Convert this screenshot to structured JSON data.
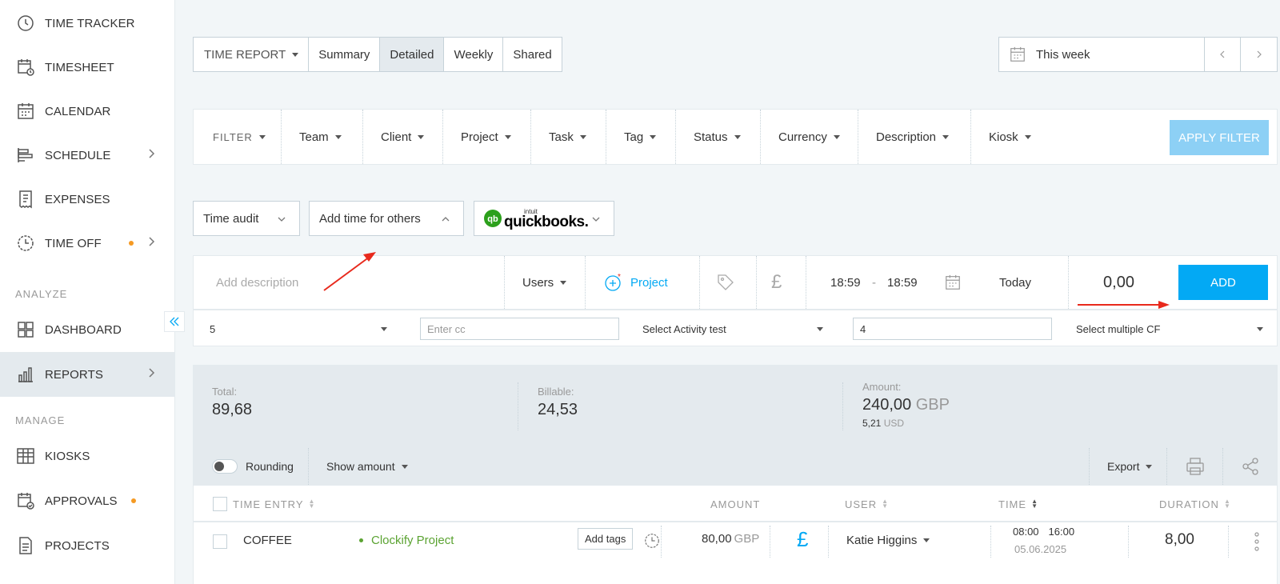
{
  "sidebar": {
    "items": [
      {
        "label": "TIME TRACKER"
      },
      {
        "label": "TIMESHEET"
      },
      {
        "label": "CALENDAR"
      },
      {
        "label": "SCHEDULE"
      },
      {
        "label": "EXPENSES"
      },
      {
        "label": "TIME OFF"
      },
      {
        "label": "DASHBOARD"
      },
      {
        "label": "REPORTS"
      },
      {
        "label": "KIOSKS"
      },
      {
        "label": "APPROVALS"
      },
      {
        "label": "PROJECTS"
      }
    ],
    "section_analyze": "ANALYZE",
    "section_manage": "MANAGE"
  },
  "report_tabs": {
    "type_label": "TIME REPORT",
    "tabs": [
      "Summary",
      "Detailed",
      "Weekly",
      "Shared"
    ],
    "active": "Detailed"
  },
  "date_range": {
    "label": "This week"
  },
  "filter": {
    "label": "FILTER",
    "items": [
      "Team",
      "Client",
      "Project",
      "Task",
      "Tag",
      "Status",
      "Currency",
      "Description",
      "Kiosk"
    ],
    "apply_label": "APPLY FILTER"
  },
  "actions": {
    "time_audit": "Time audit",
    "add_time_others": "Add time for others",
    "quickbooks_small": "intuit",
    "quickbooks": "quickbooks."
  },
  "entry": {
    "description_placeholder": "Add description",
    "users": "Users",
    "project": "Project",
    "currency_symbol": "£",
    "start": "18:59",
    "dash": "-",
    "end": "18:59",
    "date": "Today",
    "duration": "0,00",
    "add_label": "ADD"
  },
  "custom_fields": {
    "number_value": "5",
    "cc_placeholder": "Enter cc",
    "activity": "Select Activity test",
    "text_value": "4",
    "multi_cf": "Select multiple CF"
  },
  "totals": {
    "total_label": "Total:",
    "total_value": "89,68",
    "billable_label": "Billable:",
    "billable_value": "24,53",
    "amount_label": "Amount:",
    "amount_value": "240,00",
    "amount_currency": "GBP",
    "amount_secondary": "5,21",
    "amount_secondary_currency": "USD"
  },
  "toolbar": {
    "rounding": "Rounding",
    "show_amount": "Show amount",
    "export": "Export"
  },
  "table": {
    "headers": {
      "time_entry": "TIME ENTRY",
      "amount": "AMOUNT",
      "user": "USER",
      "time": "TIME",
      "duration": "DURATION"
    },
    "rows": [
      {
        "description": "COFFEE",
        "project": "Clockify Project",
        "add_tags": "Add tags",
        "amount": "80,00",
        "amount_currency": "GBP",
        "billable_symbol": "£",
        "user": "Katie Higgins",
        "start": "08:00",
        "end": "16:00",
        "date": "05.06.2025",
        "duration": "8,00"
      }
    ]
  },
  "colors": {
    "accent": "#03a9f4",
    "apply_disabled": "#8dd0f5",
    "project_green": "#5ba332",
    "warning_dot": "#f59a23",
    "annotation_arrow": "#e8291c"
  }
}
